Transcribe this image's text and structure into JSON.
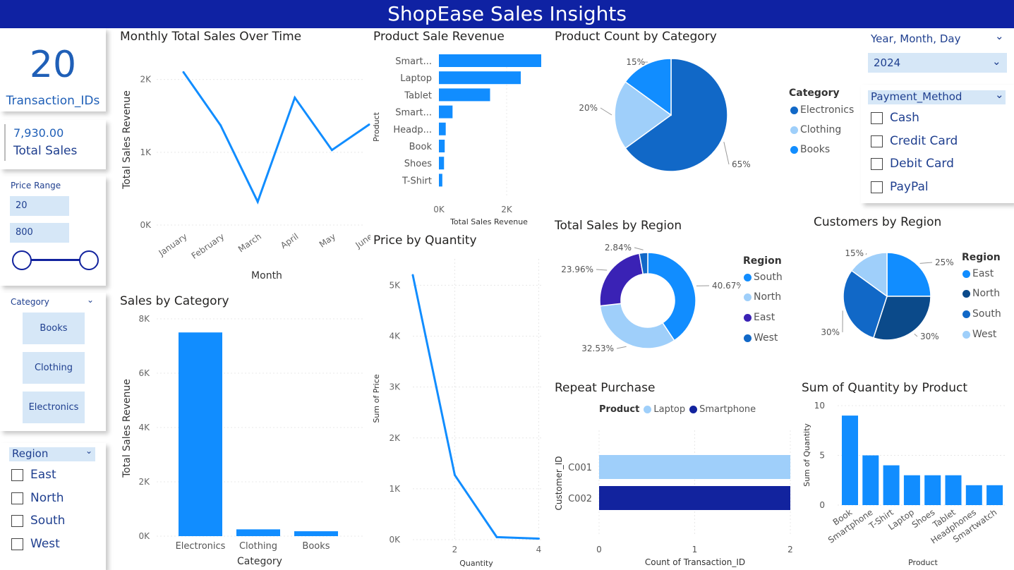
{
  "header": {
    "title": "ShopEase Sales Insights"
  },
  "kpis": {
    "transactions_value": "20",
    "transactions_label": "Transaction_IDs",
    "sales_value": "7,930.00",
    "sales_label": "Total Sales"
  },
  "price_range": {
    "label": "Price Range",
    "min": "20",
    "max": "800"
  },
  "category_slicer": {
    "label": "Category",
    "options": [
      "Books",
      "Clothing",
      "Electronics"
    ]
  },
  "region_slicer": {
    "label": "Region",
    "options": [
      "East",
      "North",
      "South",
      "West"
    ]
  },
  "date_slicer": {
    "label": "Year, Month, Day",
    "value": "2024"
  },
  "payment_slicer": {
    "label": "Payment_Method",
    "options": [
      "Cash",
      "Credit Card",
      "Debit Card",
      "PayPal"
    ]
  },
  "colors": {
    "primary": "#118dff",
    "dark_blue": "#12239e",
    "navy": "#0f22a3",
    "mid_blue": "#1168c7",
    "light_blue": "#9fcffa",
    "purple": "#3a22b5",
    "deep_blue": "#0b4a8a"
  },
  "chart_data": [
    {
      "id": "monthly",
      "type": "line",
      "title": "Monthly Total Sales Over Time",
      "xlabel": "Month",
      "ylabel": "Total Sales Revenue",
      "categories": [
        "January",
        "February",
        "March",
        "April",
        "May",
        "June"
      ],
      "values": [
        2100,
        1370,
        320,
        1750,
        1030,
        1380
      ],
      "ylim": [
        0,
        2200
      ],
      "yticks": [
        "0K",
        "1K",
        "2K"
      ]
    },
    {
      "id": "product_revenue",
      "type": "bar",
      "orientation": "horizontal",
      "title": "Product Sale Revenue",
      "xlabel": "Total Sales Revenue",
      "ylabel": "Product",
      "categories": [
        "Smart...",
        "Laptop",
        "Tablet",
        "Smart...",
        "Headp...",
        "Book",
        "Shoes",
        "T-Shirt"
      ],
      "values": [
        3000,
        2400,
        1500,
        400,
        200,
        170,
        150,
        100
      ],
      "xlim": [
        0,
        3000
      ],
      "xticks": [
        "0K",
        "2K"
      ]
    },
    {
      "id": "product_count",
      "type": "pie",
      "title": "Product Count by Category",
      "legend_title": "Category",
      "labels": [
        "Electronics",
        "Clothing",
        "Books"
      ],
      "values": [
        65,
        20,
        15
      ],
      "percent_labels": [
        "65%",
        "20%",
        "15%"
      ]
    },
    {
      "id": "sales_category",
      "type": "bar",
      "title": "Sales by Category",
      "xlabel": "Category",
      "ylabel": "Total Sales Revenue",
      "categories": [
        "Electronics",
        "Clothing",
        "Books"
      ],
      "values": [
        7500,
        250,
        180
      ],
      "ylim": [
        0,
        8000
      ],
      "yticks": [
        "0K",
        "2K",
        "4K",
        "6K",
        "8K"
      ]
    },
    {
      "id": "price_qty",
      "type": "line",
      "title": "Price by Quantity",
      "xlabel": "Quantity",
      "ylabel": "Sum of Price",
      "x": [
        1,
        2,
        3,
        4
      ],
      "values": [
        5200,
        1270,
        50,
        20
      ],
      "ylim": [
        0,
        5400
      ],
      "yticks": [
        "0K",
        "1K",
        "2K",
        "3K",
        "4K",
        "5K"
      ],
      "xticks": [
        "2",
        "4"
      ]
    },
    {
      "id": "region_sales",
      "type": "pie",
      "variant": "donut",
      "title": "Total Sales by Region",
      "legend_title": "Region",
      "labels": [
        "South",
        "North",
        "East",
        "West"
      ],
      "values": [
        40.67,
        32.53,
        23.96,
        2.84
      ],
      "percent_labels": [
        "40.67%",
        "32.53%",
        "23.96%",
        "2.84%"
      ]
    },
    {
      "id": "customers_region",
      "type": "pie",
      "title": "Customers by Region",
      "legend_title": "Region",
      "labels": [
        "East",
        "North",
        "South",
        "West"
      ],
      "values": [
        25,
        30,
        30,
        15
      ],
      "percent_labels": [
        "25%",
        "30%",
        "30%",
        "15%"
      ]
    },
    {
      "id": "repeat",
      "type": "bar",
      "orientation": "horizontal",
      "title": "Repeat Purchase",
      "xlabel": "Count of Transaction_ID",
      "ylabel": "Customer_ID",
      "legend_title": "Product",
      "series": [
        {
          "name": "Laptop"
        },
        {
          "name": "Smartphone"
        }
      ],
      "categories": [
        "C001",
        "C002"
      ],
      "values": [
        2,
        2
      ],
      "xlim": [
        0,
        2
      ],
      "xticks": [
        "0",
        "1",
        "2"
      ]
    },
    {
      "id": "qty_product",
      "type": "bar",
      "title": "Sum of Quantity by Product",
      "xlabel": "Product",
      "ylabel": "Sum of Quantity",
      "categories": [
        "Book",
        "Smartphone",
        "T-Shirt",
        "Laptop",
        "Shoes",
        "Tablet",
        "Headphones",
        "Smartwatch"
      ],
      "values": [
        9,
        5,
        4,
        3,
        3,
        3,
        2,
        2
      ],
      "ylim": [
        0,
        10
      ],
      "yticks": [
        "0",
        "5",
        "10"
      ]
    }
  ]
}
